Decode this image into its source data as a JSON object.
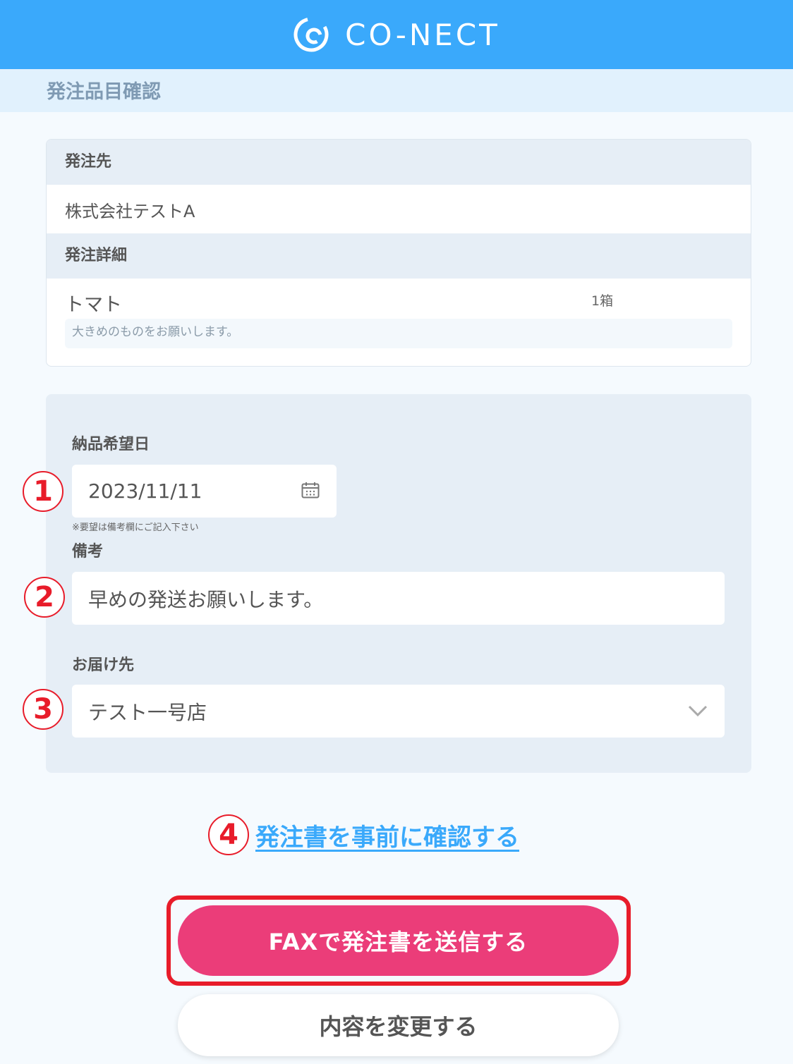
{
  "header": {
    "logo_text": "CO-NECT"
  },
  "page_title": "発注品目確認",
  "order_card": {
    "supplier_label": "発注先",
    "supplier_name": "株式会社テストA",
    "details_label": "発注詳細",
    "item_name": "トマト",
    "item_qty": "1箱",
    "item_note": "大きめのものをお願いします。"
  },
  "form": {
    "delivery_date_label": "納品希望日",
    "delivery_date_value": "2023/11/11",
    "hint": "※要望は備考欄にご記入下さい",
    "remarks_label": "備考",
    "remarks_value": "早めの発送お願いします。",
    "destination_label": "お届け先",
    "destination_value": "テスト一号店"
  },
  "annotations": {
    "n1": "1",
    "n2": "2",
    "n3": "3",
    "n4": "4"
  },
  "preview_link": "発注書を事前に確認する",
  "buttons": {
    "send_fax": "FAXで発注書を送信する",
    "edit": "内容を変更する"
  },
  "colors": {
    "header_bg": "#3aa9fb",
    "primary_button": "#eb3d79",
    "annotation_red": "#e81c2a",
    "link": "#3aa9fb"
  }
}
